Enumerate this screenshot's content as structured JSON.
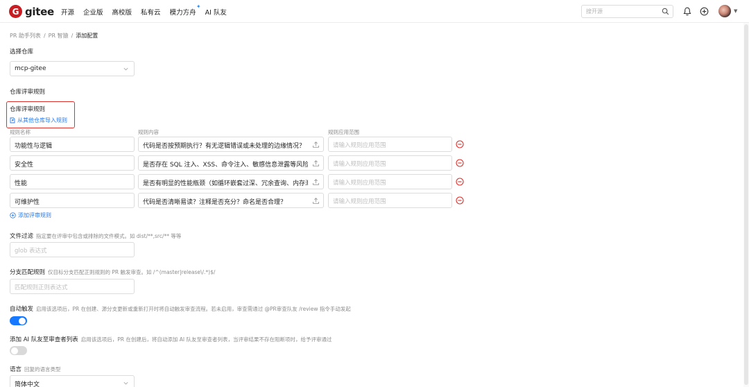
{
  "header": {
    "logo_text": "gitee",
    "nav": [
      {
        "label": "开源"
      },
      {
        "label": "企业版"
      },
      {
        "label": "高校版"
      },
      {
        "label": "私有云"
      },
      {
        "label": "模力方舟"
      },
      {
        "label": "AI 队友"
      }
    ],
    "search_placeholder": "搜开源"
  },
  "breadcrumb": {
    "items": [
      "PR 助手列表",
      "PR 智猿"
    ],
    "current": "添加配置",
    "separator": "/"
  },
  "repo": {
    "label": "选择仓库",
    "selected": "mcp-gitee"
  },
  "rules_section": {
    "title": "仓库评审规则",
    "subtitle": "仓库评审规则",
    "import_label": "从其他仓库导入规则",
    "col_name": "规则名称",
    "col_content": "规则内容",
    "col_scope": "规则应用范围",
    "scope_placeholder": "请输入规则应用范围",
    "rows": [
      {
        "name": "功能性与逻辑",
        "content": "代码是否按预期执行？有无逻辑错误或未处理的边缘情况？"
      },
      {
        "name": "安全性",
        "content": "是否存在 SQL 注入、XSS、命令注入、敏感信息泄露等风险？"
      },
      {
        "name": "性能",
        "content": "是否有明显的性能瓶颈（如循环嵌套过深、冗余查询、内存泄漏）？"
      },
      {
        "name": "可维护性",
        "content": "代码是否清晰易读？注释是否充分？命名是否合理？"
      }
    ],
    "add_label": "添加评审规则"
  },
  "file_filter": {
    "label": "文件过滤",
    "hint": "指定要在评审中包含或排除的文件模式。如 dist/**,src/** 等等",
    "placeholder": "glob 表达式"
  },
  "branch_match": {
    "label": "分支匹配规则",
    "hint": "仅目标分支匹配正则规则的 PR 触发审查。如 /^(master|release\\/.*)$/",
    "placeholder": "匹配规则正则表达式"
  },
  "auto_trigger": {
    "label": "自动触发",
    "hint": "启用该选项后，PR 在创建、源分支更新或重新打开时将自动触发审查流程。若未启用，审查需通过 @PR审查队友 /review 指令手动发起",
    "enabled": true
  },
  "add_ai_reviewer": {
    "label": "添加 AI 队友至审查者列表",
    "hint": "启用该选项后，PR 在创建后，将自动添加 AI 队友至审查者列表，当评审结果不存在阻断项时，给予评审通过",
    "enabled": false
  },
  "language": {
    "label": "语言",
    "hint": "回复的语言类型",
    "selected": "简体中文"
  },
  "colors": {
    "accent": "#1677ff",
    "link": "#2c7be5",
    "danger": "#e0322c",
    "brand": "#c71d23"
  }
}
